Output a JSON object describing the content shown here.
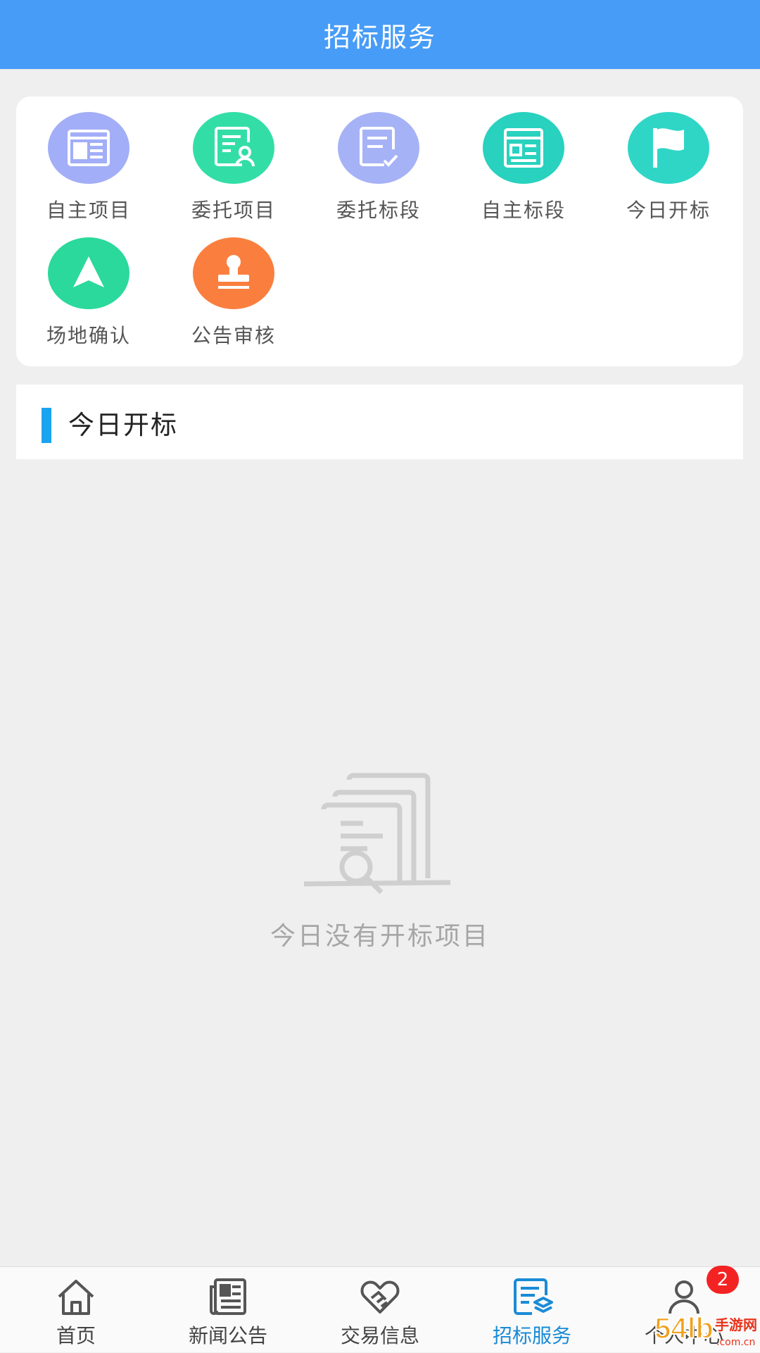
{
  "header": {
    "title": "招标服务"
  },
  "menu": {
    "items": [
      {
        "label": "自主项目",
        "icon": "newspaper-icon",
        "color": "#a2aef7"
      },
      {
        "label": "委托项目",
        "icon": "document-person-icon",
        "color": "#33dea6"
      },
      {
        "label": "委托标段",
        "icon": "document-check-icon",
        "color": "#a6b2f6"
      },
      {
        "label": "自主标段",
        "icon": "form-icon",
        "color": "#28d2be"
      },
      {
        "label": "今日开标",
        "icon": "flag-icon",
        "color": "#2fd6c6"
      },
      {
        "label": "场地确认",
        "icon": "navigation-arrow-icon",
        "color": "#2ad99b"
      },
      {
        "label": "公告审核",
        "icon": "stamp-icon",
        "color": "#fa7f3f"
      }
    ]
  },
  "section": {
    "title": "今日开标"
  },
  "empty_state": {
    "text": "今日没有开标项目",
    "icon": "document-search-icon"
  },
  "tabbar": {
    "tabs": [
      {
        "label": "首页",
        "icon": "home-icon",
        "active": false
      },
      {
        "label": "新闻公告",
        "icon": "news-icon",
        "active": false
      },
      {
        "label": "交易信息",
        "icon": "handshake-icon",
        "active": false
      },
      {
        "label": "招标服务",
        "icon": "bidding-service-icon",
        "active": true
      },
      {
        "label": "个人中心",
        "icon": "user-icon",
        "active": false
      }
    ],
    "badge": "2"
  },
  "colors": {
    "header": "#479cf7",
    "accent": "#1aa3ee",
    "active_tab": "#1a8bd6",
    "badge": "#f42323"
  },
  "watermark": {
    "text": "54lb手游网",
    "subtext": ".com.cn"
  }
}
